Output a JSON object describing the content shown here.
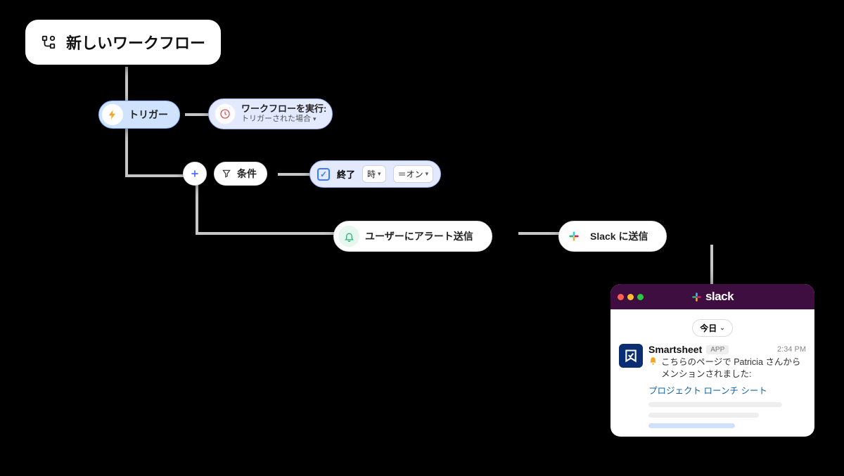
{
  "workflow": {
    "title": "新しいワークフロー",
    "trigger_label": "トリガー",
    "run_label": "ワークフローを実行:",
    "run_sub": "トリガーされた場合",
    "condition_label": "条件",
    "cond_field": "終了",
    "cond_drop1": "時",
    "cond_eq": "＝オン",
    "alert_label": "ユーザーにアラート送信",
    "slack_label": "Slack に送信"
  },
  "slack": {
    "brand": "slack",
    "today": "今日",
    "app_name": "Smartsheet",
    "app_badge": "APP",
    "time": "2:34 PM",
    "message": "こちらのページで Patricia さんからメンションされました:",
    "link": "プロジェクト ローンチ シート"
  },
  "colors": {
    "bolt": "#f5a623",
    "clock": "#e55353",
    "plus": "#4a6cf7",
    "bell": "#25b36b",
    "link": "#1264a3"
  }
}
